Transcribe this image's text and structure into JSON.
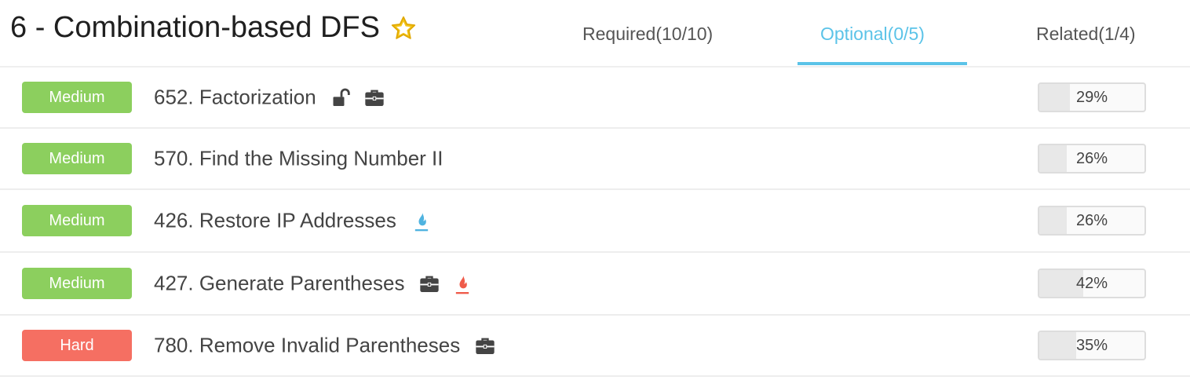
{
  "header": {
    "title": "6 - Combination-based DFS"
  },
  "tabs": [
    {
      "label": "Required(10/10)",
      "active": false
    },
    {
      "label": "Optional(0/5)",
      "active": true
    },
    {
      "label": "Related(1/4)",
      "active": false
    }
  ],
  "colors": {
    "medium": "#8ccf5e",
    "hard": "#f56f62",
    "accent": "#5bc3e8",
    "star": "#f5c518",
    "fire_blue": "#4fb3e0",
    "fire_red": "#ef5b4a"
  },
  "problems": [
    {
      "difficulty": "Medium",
      "title": "652. Factorization",
      "icons": [
        "unlock-icon",
        "briefcase-icon"
      ],
      "progress": "29%",
      "progress_value": 0.29
    },
    {
      "difficulty": "Medium",
      "title": "570. Find the Missing Number II",
      "icons": [],
      "progress": "26%",
      "progress_value": 0.26
    },
    {
      "difficulty": "Medium",
      "title": "426. Restore IP Addresses",
      "icons": [
        "fire-blue-icon"
      ],
      "progress": "26%",
      "progress_value": 0.26
    },
    {
      "difficulty": "Medium",
      "title": "427. Generate Parentheses",
      "icons": [
        "briefcase-icon",
        "fire-red-icon"
      ],
      "progress": "42%",
      "progress_value": 0.42
    },
    {
      "difficulty": "Hard",
      "title": "780. Remove Invalid Parentheses",
      "icons": [
        "briefcase-icon"
      ],
      "progress": "35%",
      "progress_value": 0.35
    }
  ]
}
